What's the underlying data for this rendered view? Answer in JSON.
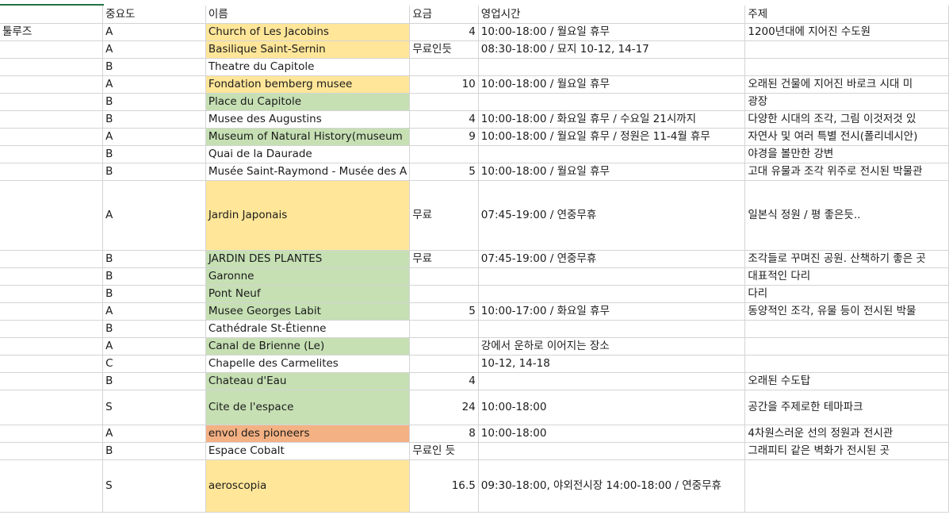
{
  "header": {
    "col_a": "",
    "col_b": "중요도",
    "col_c": "이름",
    "col_d": "요금",
    "col_e": "영업시간",
    "col_f": "주제"
  },
  "rows": [
    {
      "a": "툴루즈",
      "b": "A",
      "c": "Church of Les Jacobins",
      "d": "4",
      "e": "10:00-18:00 / 월요일 휴무",
      "f": "1200년대에 지어진 수도원",
      "c_bg": "yellow",
      "d_align": "right",
      "h": 22
    },
    {
      "a": "",
      "b": "A",
      "c": "Basilique Saint-Sernin",
      "d": "무료인듯",
      "e": "08:30-18:00 / 묘지 10-12, 14-17",
      "f": "",
      "c_bg": "yellow",
      "d_align": "left",
      "h": 22
    },
    {
      "a": "",
      "b": "B",
      "c": "Theatre du Capitole",
      "d": "",
      "e": "",
      "f": "",
      "c_bg": "",
      "d_align": "left",
      "h": 22
    },
    {
      "a": "",
      "b": "A",
      "c": "Fondation bemberg musee",
      "d": "10",
      "e": "10:00-18:00 / 월요일 휴무",
      "f": "오래된 건물에 지어진 바로크 시대  미",
      "c_bg": "yellow",
      "d_align": "right",
      "h": 22
    },
    {
      "a": "",
      "b": "B",
      "c": "Place du Capitole",
      "d": "",
      "e": "",
      "f": "광장",
      "c_bg": "green",
      "d_align": "left",
      "h": 22
    },
    {
      "a": "",
      "b": "B",
      "c": "Musee des Augustins",
      "d": "4",
      "e": "10:00-18:00 / 화요일 휴무 / 수요일 21시까지",
      "f": "다양한 시대의 조각, 그림 이것저것 있",
      "c_bg": "",
      "d_align": "right",
      "h": 22
    },
    {
      "a": "",
      "b": "A",
      "c": "Museum of Natural History(museum",
      "d": "9",
      "e": "10:00-18:00 / 월요일 휴무 / 정원은 11-4월 휴무",
      "f": "자연사 및 여러 특별 전시(폴리네시안)",
      "c_bg": "green",
      "d_align": "right",
      "h": 22
    },
    {
      "a": "",
      "b": "B",
      "c": "Quai de la Daurade",
      "d": "",
      "e": "",
      "f": "야경을 볼만한 강변",
      "c_bg": "",
      "d_align": "left",
      "h": 22
    },
    {
      "a": "",
      "b": "B",
      "c": "Musée Saint-Raymond - Musée des A",
      "d": "5",
      "e": "10:00-18:00 / 월요일 휴무",
      "f": "고대 유물과 조각 위주로 전시된 박물관",
      "c_bg": "",
      "d_align": "right",
      "h": 22
    },
    {
      "a": "",
      "b": "A",
      "c": "Jardin Japonais",
      "d": "무료",
      "e": "07:45-19:00 / 연중무휴",
      "f": "일본식 정원 / 평 좋은듯..",
      "c_bg": "yellow",
      "d_align": "left",
      "h": 88
    },
    {
      "a": "",
      "b": "B",
      "c": "JARDIN DES PLANTES",
      "d": "무료",
      "e": "07:45-19:00 / 연중무휴",
      "f": "조각들로 꾸며진 공원. 산책하기 좋은 곳",
      "c_bg": "green",
      "d_align": "left",
      "h": 22
    },
    {
      "a": "",
      "b": "B",
      "c": "Garonne",
      "d": "",
      "e": "",
      "f": "대표적인 다리",
      "c_bg": "green",
      "d_align": "left",
      "h": 22
    },
    {
      "a": "",
      "b": "B",
      "c": "Pont Neuf",
      "d": "",
      "e": "",
      "f": "다리",
      "c_bg": "green",
      "d_align": "left",
      "h": 22
    },
    {
      "a": "",
      "b": "A",
      "c": "Musee Georges Labit",
      "d": "5",
      "e": "10:00-17:00 / 화요일 휴무",
      "f": "동양적인 조각, 유물 등이 전시된 박물",
      "c_bg": "green",
      "d_align": "right",
      "h": 22
    },
    {
      "a": "",
      "b": "B",
      "c": "Cathédrale St-Étienne",
      "d": "",
      "e": "",
      "f": "",
      "c_bg": "",
      "d_align": "left",
      "h": 22
    },
    {
      "a": "",
      "b": "A",
      "c": "Canal de Brienne (Le)",
      "d": "",
      "e": "강에서 운하로 이어지는 장소",
      "f": "",
      "c_bg": "green",
      "d_align": "left",
      "h": 22
    },
    {
      "a": "",
      "b": "C",
      "c": "Chapelle des Carmelites",
      "d": "",
      "e": "10-12, 14-18",
      "f": "",
      "c_bg": "",
      "d_align": "left",
      "h": 22
    },
    {
      "a": "",
      "b": "B",
      "c": "Chateau d'Eau",
      "d": "4",
      "e": "",
      "f": "오래된 수도탑",
      "c_bg": "green",
      "d_align": "right",
      "h": 22
    },
    {
      "a": "",
      "b": "S",
      "c": "Cite de l'espace",
      "d": "24",
      "e": "10:00-18:00",
      "f": "공간을 주제로한 테마파크",
      "c_bg": "green",
      "d_align": "right",
      "h": 44
    },
    {
      "a": "",
      "b": "A",
      "c": "envol des pioneers",
      "d": "8",
      "e": "10:00-18:00",
      "f": "4차원스러운 선의 정원과 전시관",
      "c_bg": "orange",
      "d_align": "right",
      "h": 22
    },
    {
      "a": "",
      "b": "B",
      "c": "Espace Cobalt",
      "d": "무료인 듯",
      "e": "",
      "f": "그래피티 같은 벽화가 전시된 곳",
      "c_bg": "",
      "d_align": "left",
      "h": 22
    },
    {
      "a": "",
      "b": "S",
      "c": "aeroscopia",
      "d": "16.5",
      "e": "09:30-18:00, 야외전시장 14:00-18:00 / 연중무휴",
      "f": "",
      "c_bg": "yellow",
      "d_align": "right",
      "h": 66
    }
  ]
}
